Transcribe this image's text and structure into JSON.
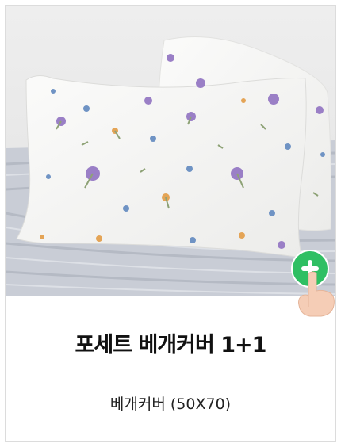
{
  "product": {
    "title": "포세트 베개커버 1+1",
    "option": "베개커버 (50X70)"
  },
  "colors": {
    "add_button": "#2fbf63",
    "mattress": "#c9cdd6",
    "pillow": "#f6f6f4"
  }
}
